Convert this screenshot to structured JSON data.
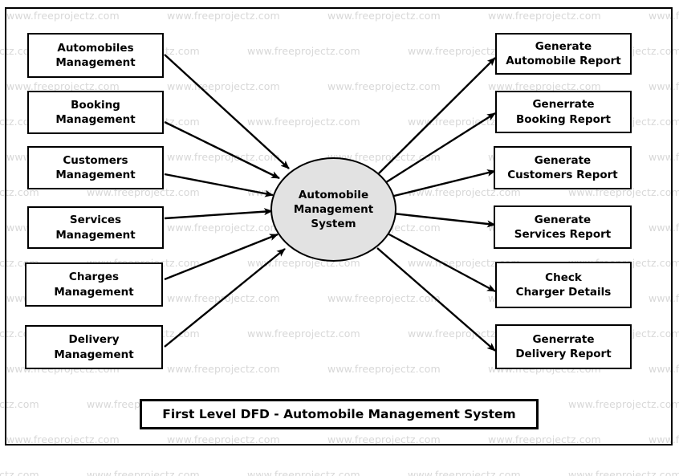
{
  "diagram": {
    "title": "First Level DFD - Automobile Management System",
    "process": {
      "line1": "Automobile",
      "line2": "Management",
      "line3": "System",
      "fill": "#e2e2e2"
    },
    "watermark_text": "www.freeprojectz.com",
    "watermark_color": "#d8d8d8",
    "inputs": [
      {
        "line1": "Automobiles",
        "line2": "Management"
      },
      {
        "line1": "Booking",
        "line2": "Management"
      },
      {
        "line1": "Customers",
        "line2": "Management"
      },
      {
        "line1": "Services",
        "line2": "Management"
      },
      {
        "line1": "Charges",
        "line2": "Management"
      },
      {
        "line1": "Delivery",
        "line2": "Management"
      }
    ],
    "outputs": [
      {
        "line1": "Generate",
        "line2": "Automobile Report"
      },
      {
        "line1": "Generrate",
        "line2": "Booking Report"
      },
      {
        "line1": "Generate",
        "line2": "Customers Report"
      },
      {
        "line1": "Generate",
        "line2": "Services Report"
      },
      {
        "line1": "Check",
        "line2": "Charger Details"
      },
      {
        "line1": "Generrate",
        "line2": "Delivery Report"
      }
    ]
  }
}
